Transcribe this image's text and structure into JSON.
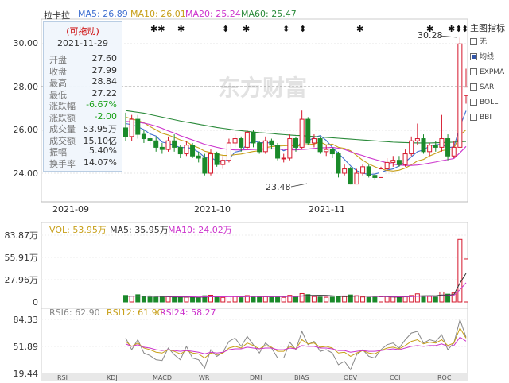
{
  "stock": {
    "name": "拉卡拉"
  },
  "ma_legend": [
    {
      "label": "MA5: 26.89",
      "color": "#3f6fd1"
    },
    {
      "label": "MA10: 26.01",
      "color": "#c79f18"
    },
    {
      "label": "MA20: 25.24",
      "color": "#cc33cc"
    },
    {
      "label": "MA60: 25.47",
      "color": "#2a8a3a"
    }
  ],
  "tooltip": {
    "header": "(可拖动)",
    "date": "2021-11-29",
    "rows": [
      {
        "label": "开盘",
        "value": "27.60",
        "color": "#333333"
      },
      {
        "label": "收盘",
        "value": "27.99",
        "color": "#333333"
      },
      {
        "label": "最高",
        "value": "28.84",
        "color": "#333333"
      },
      {
        "label": "最低",
        "value": "27.22",
        "color": "#333333"
      },
      {
        "label": "涨跌幅",
        "value": "-6.67%",
        "color": "#19a119"
      },
      {
        "label": "涨跌额",
        "value": "-2.00",
        "color": "#19a119"
      },
      {
        "label": "成交量",
        "value": "53.95万",
        "color": "#333333"
      },
      {
        "label": "成交额",
        "value": "15.10亿",
        "color": "#333333"
      },
      {
        "label": "振幅",
        "value": "5.40%",
        "color": "#333333"
      },
      {
        "label": "换手率",
        "value": "14.07%",
        "color": "#333333"
      }
    ]
  },
  "side_panel": {
    "title": "主图指标",
    "options": [
      {
        "label": "无",
        "checked": false
      },
      {
        "label": "均线",
        "checked": true
      },
      {
        "label": "EXPMA",
        "checked": false
      },
      {
        "label": "SAR",
        "checked": false
      },
      {
        "label": "BOLL",
        "checked": false
      },
      {
        "label": "BBI",
        "checked": false
      }
    ]
  },
  "watermark": "东方财富",
  "price_axis": {
    "labels": [
      "30.00",
      "28.00",
      "26.00",
      "24.00"
    ]
  },
  "date_axis": {
    "labels": [
      "2021-09",
      "2021-10",
      "2021-11"
    ]
  },
  "annotations": {
    "high": "30.28",
    "low": "23.48"
  },
  "volume": {
    "legend": [
      {
        "label": "VOL: 53.95万",
        "color": "#c79f18"
      },
      {
        "label": "MA5: 35.95万",
        "color": "#333333"
      },
      {
        "label": "MA10: 24.02万",
        "color": "#cc33cc"
      }
    ],
    "axis_labels": [
      "83.87万",
      "55.91万",
      "27.96万",
      "0"
    ]
  },
  "rsi": {
    "legend": [
      {
        "label": "RSI6: 62.90",
        "color": "#888888"
      },
      {
        "label": "RSI12: 61.90",
        "color": "#c79f18"
      },
      {
        "label": "RSI24: 58.27",
        "color": "#cc33cc"
      }
    ],
    "axis_labels": [
      "84.33",
      "51.89",
      "19.44"
    ]
  },
  "indicator_tabs": [
    "RSI",
    "KDJ",
    "MACD",
    "WR",
    "DMI",
    "BIAS",
    "OBV",
    "CCI",
    "ROC"
  ],
  "chart_data": {
    "type": "candlestick",
    "title": "拉卡拉",
    "ylim": [
      23.2,
      31.0
    ],
    "dates": [
      "2021-09-01",
      "2021-09-02",
      "2021-09-03",
      "2021-09-06",
      "2021-09-07",
      "2021-09-08",
      "2021-09-09",
      "2021-09-10",
      "2021-09-13",
      "2021-09-14",
      "2021-09-15",
      "2021-09-16",
      "2021-09-17",
      "2021-09-22",
      "2021-09-23",
      "2021-09-24",
      "2021-09-27",
      "2021-09-28",
      "2021-09-29",
      "2021-09-30",
      "2021-10-08",
      "2021-10-11",
      "2021-10-12",
      "2021-10-13",
      "2021-10-14",
      "2021-10-15",
      "2021-10-18",
      "2021-10-19",
      "2021-10-20",
      "2021-10-21",
      "2021-10-22",
      "2021-10-25",
      "2021-10-26",
      "2021-10-27",
      "2021-10-28",
      "2021-10-29",
      "2021-11-01",
      "2021-11-02",
      "2021-11-03",
      "2021-11-04",
      "2021-11-05",
      "2021-11-08",
      "2021-11-09",
      "2021-11-10",
      "2021-11-11",
      "2021-11-12",
      "2021-11-15",
      "2021-11-16",
      "2021-11-17",
      "2021-11-18",
      "2021-11-19",
      "2021-11-22",
      "2021-11-23",
      "2021-11-24",
      "2021-11-25",
      "2021-11-26",
      "2021-11-29"
    ],
    "open": [
      26.1,
      25.7,
      26.5,
      25.8,
      25.6,
      25.5,
      25.2,
      25.1,
      25.5,
      25.2,
      24.9,
      25.3,
      24.8,
      24.7,
      24.0,
      24.9,
      24.4,
      24.6,
      25.4,
      25.6,
      25.2,
      25.9,
      25.4,
      25.0,
      25.5,
      25.3,
      24.7,
      24.7,
      25.6,
      25.2,
      26.5,
      25.4,
      25.6,
      25.0,
      25.1,
      24.9,
      24.0,
      24.2,
      23.5,
      24.0,
      24.3,
      23.9,
      23.8,
      24.2,
      24.5,
      24.6,
      24.4,
      24.9,
      25.5,
      25.6,
      25.0,
      25.3,
      25.2,
      25.6,
      24.8,
      25.2,
      27.6
    ],
    "close": [
      25.7,
      26.5,
      25.8,
      25.6,
      25.5,
      25.2,
      25.1,
      25.5,
      25.2,
      24.9,
      25.3,
      24.8,
      24.7,
      24.0,
      24.9,
      24.4,
      24.6,
      25.4,
      25.6,
      25.2,
      25.9,
      25.4,
      25.0,
      25.5,
      25.3,
      24.7,
      24.7,
      25.6,
      25.2,
      26.5,
      25.4,
      25.6,
      25.0,
      25.1,
      24.9,
      24.0,
      24.2,
      23.5,
      24.0,
      24.3,
      23.9,
      23.8,
      24.2,
      24.5,
      24.6,
      24.4,
      24.9,
      25.5,
      25.6,
      25.0,
      25.3,
      25.2,
      25.6,
      24.8,
      25.2,
      29.99,
      27.99
    ],
    "high": [
      26.8,
      26.7,
      26.7,
      26.0,
      25.8,
      25.7,
      25.4,
      25.7,
      25.8,
      25.3,
      25.5,
      25.4,
      25.0,
      24.9,
      25.1,
      25.0,
      24.8,
      25.6,
      25.8,
      25.7,
      26.0,
      26.0,
      25.5,
      25.7,
      25.6,
      25.4,
      24.9,
      25.8,
      25.7,
      26.9,
      26.6,
      25.8,
      25.7,
      25.3,
      25.2,
      25.0,
      24.4,
      24.3,
      24.2,
      24.4,
      24.4,
      24.0,
      24.3,
      24.7,
      24.8,
      24.8,
      25.1,
      25.7,
      26.3,
      25.8,
      25.4,
      25.5,
      26.7,
      25.8,
      25.5,
      30.28,
      28.84
    ],
    "low": [
      25.5,
      25.5,
      25.6,
      25.4,
      25.3,
      25.0,
      24.9,
      25.0,
      25.0,
      24.7,
      24.8,
      24.7,
      24.5,
      23.9,
      23.9,
      24.3,
      24.2,
      24.5,
      25.2,
      25.0,
      25.1,
      25.2,
      24.9,
      24.9,
      25.1,
      24.6,
      24.5,
      24.6,
      25.0,
      25.1,
      25.3,
      25.2,
      24.9,
      24.8,
      24.7,
      23.8,
      23.9,
      23.48,
      23.5,
      23.9,
      23.8,
      23.7,
      23.8,
      24.1,
      24.3,
      24.3,
      24.3,
      24.8,
      25.3,
      24.9,
      24.8,
      25.0,
      25.0,
      24.6,
      24.7,
      25.2,
      27.22
    ],
    "ma_series": [
      {
        "name": "MA5",
        "color": "#3f6fd1",
        "values": [
          26.3,
          26.25,
          26.15,
          26.02,
          25.82,
          25.72,
          25.44,
          25.38,
          25.3,
          25.18,
          25.2,
          25.14,
          24.98,
          24.74,
          24.74,
          24.56,
          24.52,
          24.66,
          24.98,
          25.04,
          25.34,
          25.5,
          25.42,
          25.4,
          25.42,
          25.18,
          25.04,
          25.16,
          25.1,
          25.5,
          25.48,
          25.66,
          25.74,
          25.52,
          25.2,
          24.92,
          24.64,
          24.34,
          24.12,
          24.0,
          23.94,
          23.96,
          24.04,
          24.14,
          24.2,
          24.34,
          24.52,
          24.76,
          25.0,
          25.08,
          25.26,
          25.32,
          25.34,
          25.18,
          25.22,
          26.17,
          26.89
        ]
      },
      {
        "name": "MA10",
        "color": "#c79f18",
        "values": [
          26.6,
          26.52,
          26.44,
          26.34,
          26.16,
          26.01,
          25.85,
          25.77,
          25.66,
          25.54,
          25.46,
          25.29,
          25.18,
          25.02,
          24.96,
          24.88,
          24.83,
          24.82,
          24.86,
          24.89,
          24.95,
          25.01,
          25.04,
          25.19,
          25.23,
          25.26,
          25.27,
          25.29,
          25.25,
          25.3,
          25.33,
          25.35,
          25.45,
          25.31,
          25.35,
          25.2,
          25.15,
          25.04,
          24.82,
          24.6,
          24.43,
          24.3,
          24.19,
          24.13,
          24.1,
          24.14,
          24.24,
          24.39,
          24.57,
          24.64,
          24.8,
          24.92,
          25.05,
          25.09,
          25.15,
          25.76,
          26.01
        ]
      },
      {
        "name": "MA20",
        "color": "#cc33cc",
        "values": [
          26.4,
          26.38,
          26.36,
          26.32,
          26.26,
          26.18,
          26.08,
          25.96,
          25.86,
          25.74,
          25.64,
          25.54,
          25.44,
          25.34,
          25.27,
          25.2,
          25.14,
          25.1,
          25.08,
          25.08,
          25.09,
          25.1,
          25.11,
          25.12,
          25.13,
          25.12,
          25.1,
          25.09,
          25.08,
          25.1,
          25.12,
          25.15,
          25.18,
          25.18,
          25.2,
          25.16,
          25.1,
          25.0,
          24.9,
          24.82,
          24.72,
          24.64,
          24.56,
          24.48,
          24.42,
          24.38,
          24.36,
          24.36,
          24.38,
          24.42,
          24.47,
          24.52,
          24.58,
          24.63,
          24.68,
          24.95,
          25.24
        ]
      },
      {
        "name": "MA60",
        "color": "#2a8a3a",
        "values": [
          26.9,
          26.86,
          26.82,
          26.78,
          26.72,
          26.66,
          26.6,
          26.54,
          26.48,
          26.42,
          26.37,
          26.32,
          26.27,
          26.22,
          26.17,
          26.12,
          26.08,
          26.04,
          26.0,
          25.97,
          25.94,
          25.91,
          25.88,
          25.86,
          25.84,
          25.81,
          25.79,
          25.77,
          25.75,
          25.74,
          25.72,
          25.7,
          25.68,
          25.66,
          25.64,
          25.62,
          25.6,
          25.58,
          25.56,
          25.54,
          25.52,
          25.5,
          25.48,
          25.46,
          25.44,
          25.43,
          25.42,
          25.41,
          25.4,
          25.4,
          25.4,
          25.41,
          25.42,
          25.43,
          25.44,
          25.46,
          25.47
        ]
      }
    ],
    "volume_wan": [
      8.2,
      7.5,
      9.1,
      6.8,
      6.2,
      5.9,
      6.5,
      7.2,
      6.1,
      5.8,
      6.0,
      5.5,
      5.2,
      7.8,
      8.5,
      6.3,
      5.7,
      7.1,
      6.9,
      5.4,
      8.0,
      7.3,
      6.1,
      6.6,
      5.9,
      7.2,
      5.8,
      8.3,
      6.4,
      10.5,
      9.2,
      6.8,
      6.2,
      5.9,
      6.1,
      7.4,
      6.7,
      8.8,
      7.9,
      6.3,
      5.6,
      5.8,
      6.5,
      7.0,
      6.4,
      5.9,
      6.8,
      8.1,
      10.2,
      7.6,
      6.9,
      6.2,
      12.5,
      9.8,
      11.3,
      78.6,
      53.95
    ],
    "vol_ma5_wan": [
      7.2,
      7.3,
      7.6,
      7.4,
      7.6,
      7.1,
      7.0,
      6.5,
      6.4,
      6.2,
      6.3,
      6.2,
      6.0,
      6.1,
      6.6,
      6.7,
      6.9,
      7.1,
      7.0,
      6.5,
      6.9,
      7.1,
      6.7,
      6.7,
      6.6,
      7.0,
      6.6,
      7.1,
      6.7,
      7.6,
      8.1,
      8.2,
      8.4,
      8.2,
      7.8,
      7.3,
      6.9,
      7.0,
      7.4,
      7.4,
      7.1,
      6.9,
      6.8,
      6.6,
      6.3,
      6.1,
      6.5,
      6.8,
      7.5,
      7.7,
      7.9,
      7.8,
      8.7,
      8.6,
      9.3,
      23.7,
      35.95
    ],
    "vol_ma10_wan": [
      7.5,
      7.4,
      7.5,
      7.4,
      7.3,
      7.2,
      7.2,
      7.0,
      6.9,
      6.8,
      6.7,
      6.5,
      6.3,
      6.4,
      6.6,
      6.6,
      6.5,
      6.6,
      6.8,
      6.6,
      6.8,
      6.9,
      6.8,
      6.8,
      6.8,
      6.8,
      6.8,
      7.0,
      6.8,
      7.3,
      7.4,
      7.4,
      7.4,
      7.4,
      7.4,
      7.5,
      7.6,
      7.5,
      7.6,
      7.5,
      7.2,
      7.1,
      6.9,
      6.9,
      6.7,
      6.6,
      6.7,
      6.8,
      7.2,
      7.1,
      7.1,
      7.1,
      7.7,
      7.9,
      8.3,
      15.4,
      24.02
    ],
    "rsi6": [
      62,
      48,
      60,
      44,
      41,
      36,
      35,
      50,
      42,
      36,
      52,
      38,
      36,
      26,
      48,
      40,
      45,
      58,
      62,
      52,
      64,
      54,
      44,
      56,
      50,
      38,
      38,
      57,
      48,
      70,
      54,
      58,
      46,
      48,
      44,
      30,
      34,
      24,
      42,
      48,
      40,
      38,
      48,
      54,
      56,
      50,
      60,
      68,
      70,
      56,
      60,
      58,
      66,
      48,
      56,
      84,
      62.9
    ],
    "rsi12": [
      58,
      52,
      56,
      50,
      48,
      45,
      44,
      48,
      46,
      43,
      47,
      44,
      43,
      38,
      44,
      42,
      44,
      50,
      52,
      50,
      56,
      53,
      49,
      53,
      51,
      46,
      46,
      52,
      49,
      60,
      55,
      56,
      51,
      52,
      50,
      44,
      45,
      40,
      44,
      47,
      44,
      43,
      47,
      50,
      51,
      49,
      53,
      58,
      60,
      55,
      57,
      56,
      60,
      53,
      56,
      74,
      61.9
    ],
    "rsi24": [
      55,
      52,
      54,
      51,
      50,
      48,
      47,
      48,
      47,
      46,
      47,
      46,
      45,
      43,
      45,
      44,
      45,
      48,
      49,
      49,
      51,
      50,
      49,
      50,
      50,
      48,
      48,
      50,
      49,
      53,
      52,
      52,
      50,
      50,
      49,
      47,
      47,
      45,
      46,
      47,
      46,
      46,
      47,
      48,
      49,
      48,
      50,
      52,
      53,
      52,
      53,
      53,
      55,
      52,
      53,
      63,
      58.27
    ]
  }
}
